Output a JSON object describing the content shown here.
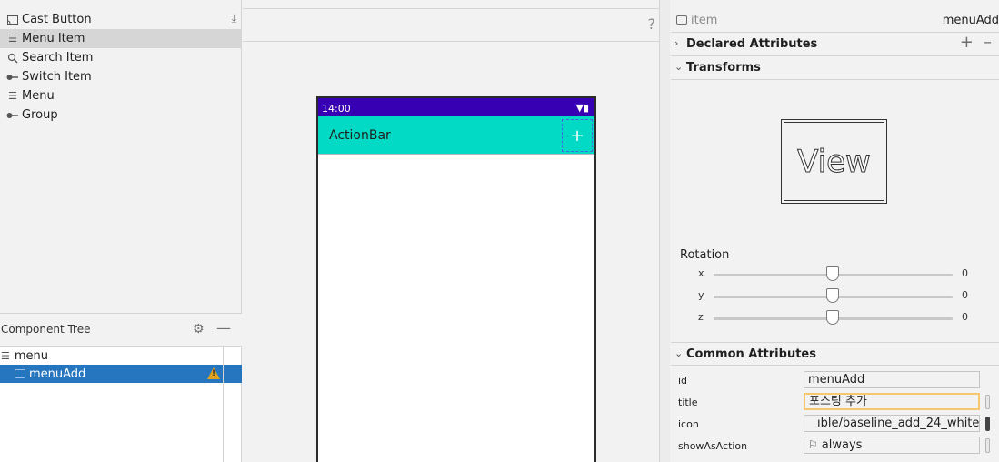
{
  "palette": {
    "items": [
      {
        "label": "Cast Button",
        "icon": "cast-icon"
      },
      {
        "label": "Menu Item",
        "icon": "menu-item-icon"
      },
      {
        "label": "Search Item",
        "icon": "search-icon"
      },
      {
        "label": "Switch Item",
        "icon": "switch-icon"
      },
      {
        "label": "Menu",
        "icon": "menu-icon"
      },
      {
        "label": "Group",
        "icon": "group-icon"
      }
    ],
    "selected_index": 1
  },
  "component_tree": {
    "title": "Component Tree",
    "nodes": [
      {
        "label": "menu",
        "depth": 0
      },
      {
        "label": "menuAdd",
        "depth": 1,
        "selected": true,
        "warning": true
      }
    ]
  },
  "canvas": {
    "help": "?",
    "phone": {
      "time": "14:00",
      "actionbar_title": "ActionBar",
      "action_icon": "+"
    },
    "colors": {
      "statusbar": "#3700b3",
      "actionbar": "#03dac5"
    }
  },
  "attributes": {
    "header": {
      "type": "item",
      "id": "menuAdd"
    },
    "sections": {
      "declared": "Declared Attributes",
      "transforms": "Transforms",
      "common": "Common Attributes"
    },
    "view_label": "View",
    "rotation": {
      "label": "Rotation",
      "axes": [
        {
          "axis": "x",
          "value": "0"
        },
        {
          "axis": "y",
          "value": "0"
        },
        {
          "axis": "z",
          "value": "0"
        }
      ]
    },
    "common": [
      {
        "name": "id",
        "value": "menuAdd"
      },
      {
        "name": "title",
        "value": "포스팅 추가"
      },
      {
        "name": "icon",
        "value": "ıble/baseline_add_24_white"
      },
      {
        "name": "showAsAction",
        "value": "always"
      }
    ]
  }
}
